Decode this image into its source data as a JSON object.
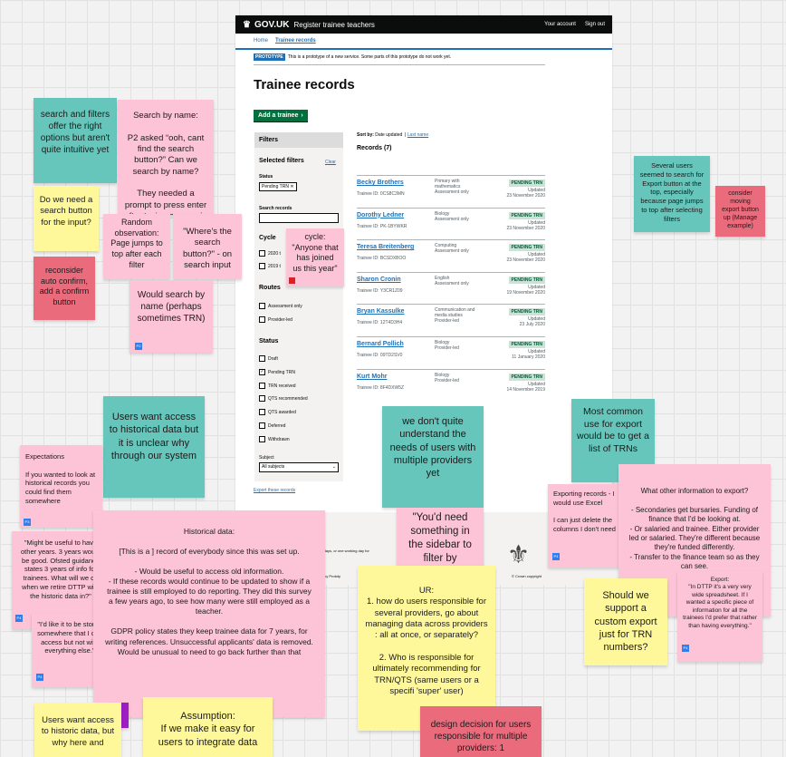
{
  "gov": {
    "logo": "GOV.UK",
    "crown": "♛",
    "service": "Register trainee teachers",
    "account": "Your account",
    "signout": "Sign out",
    "nav_home": "Home",
    "nav_trainee": "Trainee records",
    "banner_tag": "PROTOTYPE",
    "banner_text": "This is a prototype of a new service. Some parts of this prototype do not work yet.",
    "title": "Trainee records",
    "add_button": "Add a trainee",
    "filters": {
      "title": "Filters",
      "selected": "Selected filters",
      "clear": "Clear",
      "status_label": "Status",
      "status_chip": "Pending TRN ✕",
      "search_label": "Search records",
      "cycle_label": "Cycle",
      "cycle_options": [
        "2020 t",
        "2019 t"
      ],
      "routes_label": "Routes",
      "routes": [
        "Assessment only",
        "Provider-led"
      ],
      "status_heading": "Status",
      "statuses": [
        "Draft",
        "Pending TRN",
        "TRN received",
        "QTS recommended",
        "QTS awarded",
        "Deferred",
        "Withdrawn"
      ],
      "subject_label": "Subject",
      "subject_value": "All subjects"
    },
    "export_link": "Export these records",
    "sort_label": "Sort by:",
    "sort_current": "Date updated",
    "sort_other": "Last name",
    "records_count": "Records (7)",
    "records": [
      {
        "name": "Becky Brothers",
        "trn": "Trainee ID: 0CS8C3MN",
        "subject": "Primary with mathematics\nAssessment only",
        "status": "PENDING TRN",
        "updated": "Updated\n23 November 2020"
      },
      {
        "name": "Dorothy Ledner",
        "trn": "Trainee ID: PK-1BYWKR",
        "subject": "Biology\nAssessment only",
        "status": "PENDING TRN",
        "updated": "Updated\n23 November 2020"
      },
      {
        "name": "Teresa Breitenberg",
        "trn": "Trainee ID: BCSDXBOO",
        "subject": "Computing\nAssessment only",
        "status": "PENDING TRN",
        "updated": "Updated\n23 November 2020"
      },
      {
        "name": "Sharon Cronin",
        "trn": "Trainee ID: Y3CR1Z09",
        "subject": "English\nAssessment only",
        "status": "PENDING TRN",
        "updated": "Updated\n19 November 2020"
      },
      {
        "name": "Bryan Kassulke",
        "trn": "Trainee ID: 12T4D3H4",
        "subject": "Communication and media studies\nProvider-led",
        "status": "PENDING TRN",
        "updated": "Updated\n23 July 2020"
      },
      {
        "name": "Bernard Pollich",
        "trn": "Trainee ID: 09TD2SV0",
        "subject": "Biology\nProvider-led",
        "status": "PENDING TRN",
        "updated": "Updated\n11 January 2020"
      },
      {
        "name": "Kurt Mohr",
        "trn": "Trainee ID: 8F4DXW5Z",
        "subject": "Biology\nProvider-led",
        "status": "PENDING TRN",
        "updated": "Updated\n14 November 2019"
      }
    ],
    "footer_text1": "ng days, or one working day for",
    "footer_text2": "oes",
    "footer_text3": "policy   Prototy",
    "footer_copy": "© Crown copyright"
  },
  "stickies": {
    "n1": "search and filters offer the right options but aren't quite intuitive yet",
    "n2": "Search by name:\n\nP2 asked “ooh, cant find the search button?” Can we search by name?\n\nThey needed  a prompt to press enter after typing a query in the search input.",
    "n3": "Do we need a search button for the input?",
    "n4": "Random observation: Page jumps to top after each filter",
    "n5": "\"Where's the search button?\" - on search input",
    "n6": "cycle: \"Anyone that has joined us this year\"",
    "n7": "reconsider auto confirm, add a confirm button",
    "n8": "Would search by name (perhaps sometimes TRN)",
    "n9": "Several users seemed to search for Export button at the top, especially because page jumps to top after selecting filters",
    "n10": "consider moving export button up (Manage example)",
    "n11": "Users want access to historical data but it is unclear why through our system",
    "n12": "we don't quite understand the needs of users with multiple providers yet",
    "n13": "Most common use for export would be to get a list of TRNs",
    "n14": "Expectations\n\nIf you wanted to look at historical records you could find them somewhere",
    "n15": "\"Might be useful to have other years. 3 years would be good. Ofsted guidance states 3 years of info for trainees. What will we do when we retire DTTP with the historic data in?\"",
    "n16": "\"I'd like it to be stored somewhere that I can access but not with everything else.\"",
    "n17": "Historical data:\n\n[This is a ] record of everybody since this was set up.\n\n- Would be useful to access old information.\n- If these records would continue to be updated to show if a trainee is still employed to do reporting. They did this survey a few years ago, to see how many were still employed as a teacher.\n\nGDPR policy states they keep trainee data for 7 years, for writing references. Unsuccessful applicants' data is removed. Would be unusual to need to go back further than that",
    "n18": "\"You'd need something in the sidebar to filter by",
    "n19": "Exporting records - I would use Excel\n\nI can just delete the columns I don't need",
    "n20": "What other information to export?\n\n- Secondaries get bursaries. Funding of finance that I'd be looking at.\n- Or salaried and trainee. Either provider led or salaried. They're different because they're funded differently.\n- Transfer to the finance team so as they can see.",
    "n21": "UR:\n1. how do users responsible for several providers, go about managing data across providers : all at once, or separately?\n\n2. Who is responsible for ultimately recommending for TRN/QTS (same users or a specifi 'super' user)",
    "n22": "Should we support a custom export just for TRN numbers?",
    "n23": "Export:\n\"In DTTP it's a very very wide spreadsheet. If I wanted a specific piece of information for all the trainees I'd prefer that rather than having everything.\"",
    "n24": "Users want access to historic data, but why here and",
    "n25": "Assumption:\nIf we make it easy for users to integrate data",
    "n26": "design decision for users responsible for multiple providers: 1",
    "tag_p2": "P2",
    "tag_p3": "P3",
    "tag_p4": "P4"
  }
}
